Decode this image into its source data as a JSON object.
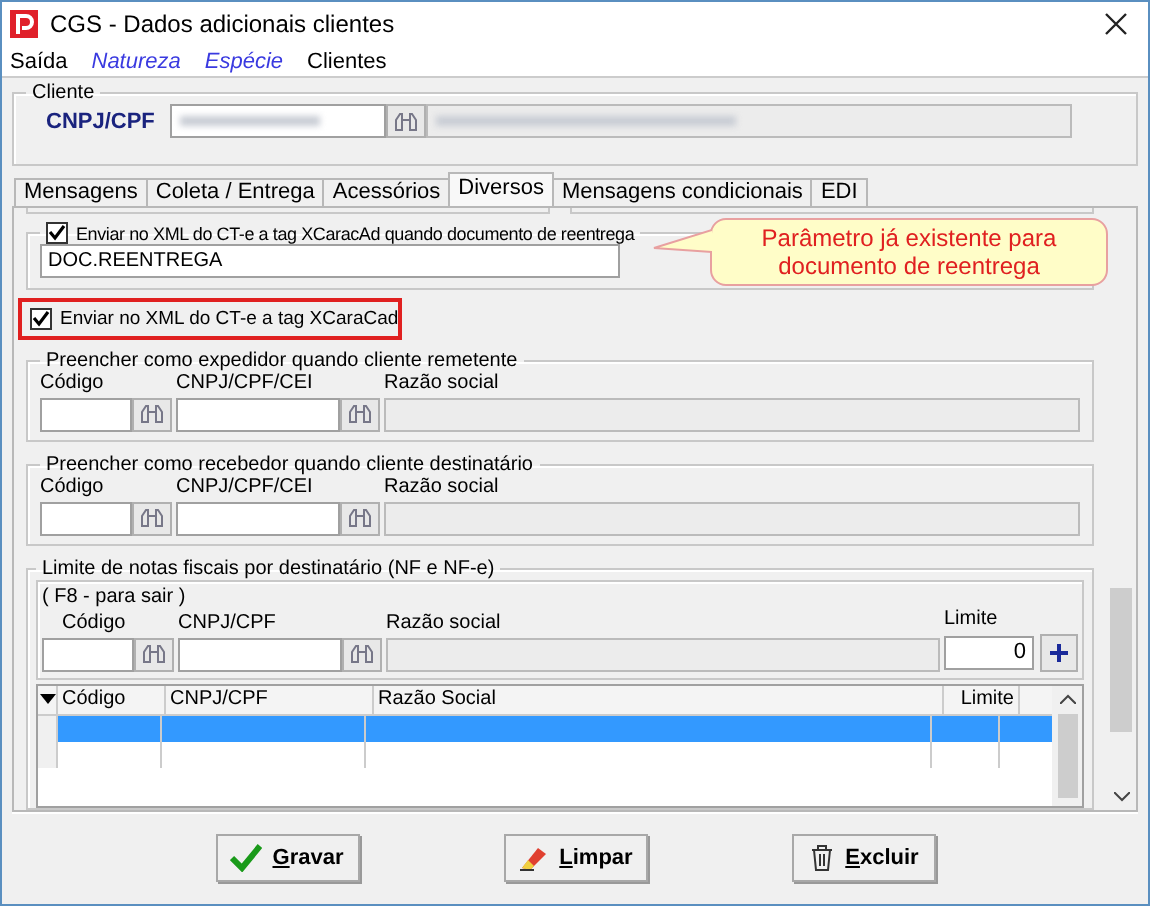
{
  "window": {
    "title": "CGS - Dados adicionais clientes"
  },
  "menu": [
    {
      "label": "Saída",
      "kind": "plain"
    },
    {
      "label": "Natureza",
      "kind": "link"
    },
    {
      "label": "Espécie",
      "kind": "link"
    },
    {
      "label": "Clientes",
      "kind": "plain"
    }
  ],
  "cliente": {
    "legend": "Cliente",
    "label": "CNPJ/CPF"
  },
  "tabs": [
    {
      "label": "Mensagens",
      "selected": false
    },
    {
      "label": "Coleta / Entrega",
      "selected": false
    },
    {
      "label": "Acessórios",
      "selected": false
    },
    {
      "label": "Diversos",
      "selected": true
    },
    {
      "label": "Mensagens condicionais",
      "selected": false
    },
    {
      "label": "EDI",
      "selected": false
    }
  ],
  "reentrega": {
    "label": "Enviar no XML do CT-e a tag XCaracAd quando documento de reentrega",
    "checked": true,
    "value": "DOC.REENTREGA"
  },
  "callout": {
    "text": "Parâmetro já existente para documento de reentrega"
  },
  "xcaracad": {
    "label": "Enviar no XML do CT-e a tag XCaraCad",
    "checked": true,
    "highlighted": true
  },
  "groups": [
    {
      "legend": "Preencher como expedidor quando cliente remetente",
      "fields": [
        "Código",
        "CNPJ/CPF/CEI",
        "Razão social"
      ]
    },
    {
      "legend": "Preencher como recebedor quando cliente destinatário",
      "fields": [
        "Código",
        "CNPJ/CPF/CEI",
        "Razão social"
      ]
    }
  ],
  "limite": {
    "legend": "Limite de notas fiscais por destinatário (NF e NF-e)",
    "hint": "( F8 - para sair )",
    "fields": [
      "Código",
      "CNPJ/CPF",
      "Razão social",
      "Limite"
    ],
    "value": "0"
  },
  "table": {
    "columns": [
      "Código",
      "CNPJ/CPF",
      "Razão Social",
      "Limite"
    ],
    "rows": [
      {
        "selected": true
      },
      {
        "selected": false
      }
    ]
  },
  "buttons": [
    {
      "label": "Gravar",
      "kind": "save"
    },
    {
      "label": "Limpar",
      "kind": "clear"
    },
    {
      "label": "Excluir",
      "kind": "delete"
    }
  ]
}
